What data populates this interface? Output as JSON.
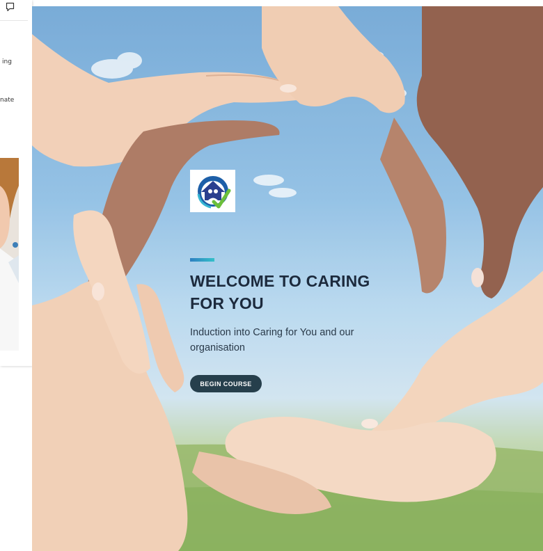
{
  "side_panel": {
    "fragments": [
      "ing",
      "nate"
    ]
  },
  "course": {
    "title": "WELCOME TO CARING FOR YOU",
    "subtitle": "Induction into Caring for You and our organisation",
    "begin_label": "BEGIN COURSE"
  },
  "colors": {
    "title": "#1c2a3d",
    "button": "#263f4c",
    "accent_start": "#2e7fc1",
    "accent_end": "#34c0c9"
  }
}
